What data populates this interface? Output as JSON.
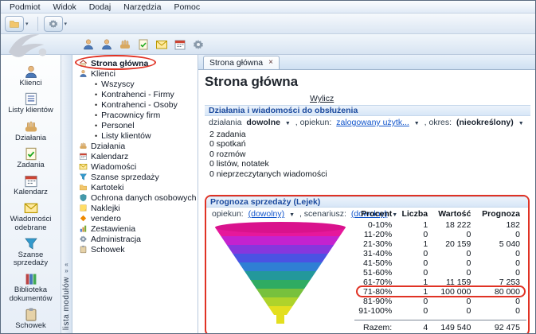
{
  "menubar": {
    "items": [
      "Podmiot",
      "Widok",
      "Dodaj",
      "Narzędzia",
      "Pomoc"
    ]
  },
  "toolbar2": {
    "icons": [
      {
        "name": "add-client",
        "icon": "person"
      },
      {
        "name": "clients",
        "icon": "person"
      },
      {
        "name": "new-activity",
        "icon": "hand"
      },
      {
        "name": "new-task",
        "icon": "task"
      },
      {
        "name": "new-message",
        "icon": "mail"
      },
      {
        "name": "calendar",
        "icon": "calendar"
      },
      {
        "name": "settings",
        "icon": "gear"
      }
    ]
  },
  "strip": {
    "vertical_label": "lista modułów"
  },
  "modules": [
    {
      "label": "Klienci",
      "icon": "person"
    },
    {
      "label": "Listy klientów",
      "icon": "list"
    },
    {
      "label": "Działania",
      "icon": "hand"
    },
    {
      "label": "Zadania",
      "icon": "task"
    },
    {
      "label": "Kalendarz",
      "icon": "calendar"
    },
    {
      "label": "Wiadomości odebrane",
      "icon": "mail"
    },
    {
      "label": "Szanse sprzedaży",
      "icon": "funnel"
    },
    {
      "label": "Biblioteka dokumentów",
      "icon": "books"
    },
    {
      "label": "Schowek",
      "icon": "clipboard"
    }
  ],
  "tree": {
    "items": [
      {
        "label": "Strona główna",
        "icon": "house",
        "selected": true
      },
      {
        "label": "Klienci",
        "icon": "person"
      },
      {
        "label": "Wszyscy",
        "child": true
      },
      {
        "label": "Kontrahenci - Firmy",
        "child": true
      },
      {
        "label": "Kontrahenci - Osoby",
        "child": true
      },
      {
        "label": "Pracownicy firm",
        "child": true
      },
      {
        "label": "Personel",
        "child": true
      },
      {
        "label": "Listy klientów",
        "child": true
      },
      {
        "label": "Działania",
        "icon": "hand"
      },
      {
        "label": "Kalendarz",
        "icon": "calendar"
      },
      {
        "label": "Wiadomości",
        "icon": "mail"
      },
      {
        "label": "Szanse sprzedaży",
        "icon": "funnel"
      },
      {
        "label": "Kartoteki",
        "icon": "folder"
      },
      {
        "label": "Ochrona danych osobowych",
        "icon": "shield"
      },
      {
        "label": "Naklejki",
        "icon": "sticker"
      },
      {
        "label": "vendero",
        "icon": "diamond"
      },
      {
        "label": "Zestawienia",
        "icon": "chart"
      },
      {
        "label": "Administracja",
        "icon": "gear"
      },
      {
        "label": "Schowek",
        "icon": "clipboard"
      }
    ]
  },
  "tab": {
    "label": "Strona główna",
    "close": "×"
  },
  "page": {
    "title": "Strona główna",
    "wylicz": "Wylicz",
    "activities": {
      "header": "Działania i wiadomości do obsłużenia",
      "f1_label": "działania",
      "f1_value": "dowolne",
      "f2_label": ", opiekun:",
      "f2_value": "zalogowany użytk...",
      "f3_label": ", okres:",
      "f3_value": "(nieokreślony)",
      "stats": [
        "2 zadania",
        "0 spotkań",
        "0 rozmów",
        "0 listów, notatek",
        "0 nieprzeczytanych wiadomości"
      ]
    },
    "forecast": {
      "header": "Prognoza sprzedaży (Lejek)",
      "f1_label": "opiekun:",
      "f1_value": "(dowolny)",
      "f2_label": ", scenariusz:",
      "f2_value": "(dowolny)"
    }
  },
  "chart_data": {
    "type": "funnel",
    "title": "Prognoza sprzedaży (Lejek)",
    "columns": [
      "Procent",
      "Liczba",
      "Wartość",
      "Prognoza"
    ],
    "rows": [
      [
        "0-10%",
        "1",
        "18 222",
        "182"
      ],
      [
        "11-20%",
        "0",
        "0",
        "0"
      ],
      [
        "21-30%",
        "1",
        "20 159",
        "5 040"
      ],
      [
        "31-40%",
        "0",
        "0",
        "0"
      ],
      [
        "41-50%",
        "0",
        "0",
        "0"
      ],
      [
        "51-60%",
        "0",
        "0",
        "0"
      ],
      [
        "61-70%",
        "1",
        "11 159",
        "7 253"
      ],
      [
        "71-80%",
        "1",
        "100 000",
        "80 000"
      ],
      [
        "81-90%",
        "0",
        "0",
        "0"
      ],
      [
        "91-100%",
        "0",
        "0",
        "0"
      ]
    ],
    "total_label": "Razem:",
    "total": [
      "4",
      "149 540",
      "92 475"
    ],
    "funnel_colors": [
      "#e6189b",
      "#c422cf",
      "#8736dd",
      "#4b52e3",
      "#2f7fd4",
      "#23989b",
      "#2fab62",
      "#77c13d",
      "#aed32b",
      "#e3df1f"
    ],
    "funnel_top_color": "#d9128d",
    "highlighted_row": "71-80%",
    "annotation_color": "#e03224"
  }
}
